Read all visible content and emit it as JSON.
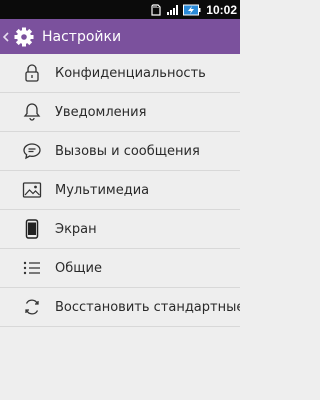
{
  "status_bar": {
    "time": "10:02",
    "icons": [
      "sd-card-icon",
      "signal-bars-icon",
      "battery-charging-icon"
    ]
  },
  "app_bar": {
    "title": "Настройки",
    "icons": [
      "back-chevron-icon",
      "gear-icon"
    ]
  },
  "settings_items": [
    {
      "label": "Конфиденциальность",
      "icon": "lock-icon"
    },
    {
      "label": "Уведомления",
      "icon": "bell-icon"
    },
    {
      "label": "Вызовы и сообщения",
      "icon": "chat-bubble-icon"
    },
    {
      "label": "Мультимедиа",
      "icon": "image-icon"
    },
    {
      "label": "Экран",
      "icon": "phone-screen-icon"
    },
    {
      "label": "Общие",
      "icon": "list-icon"
    },
    {
      "label": "Восстановить стандартные",
      "icon": "refresh-icon"
    }
  ],
  "colors": {
    "app_bar_background": "#7b519d",
    "status_bar_background": "#0b0b0b",
    "list_background": "#eeeeee",
    "divider": "#d8d8d8"
  }
}
